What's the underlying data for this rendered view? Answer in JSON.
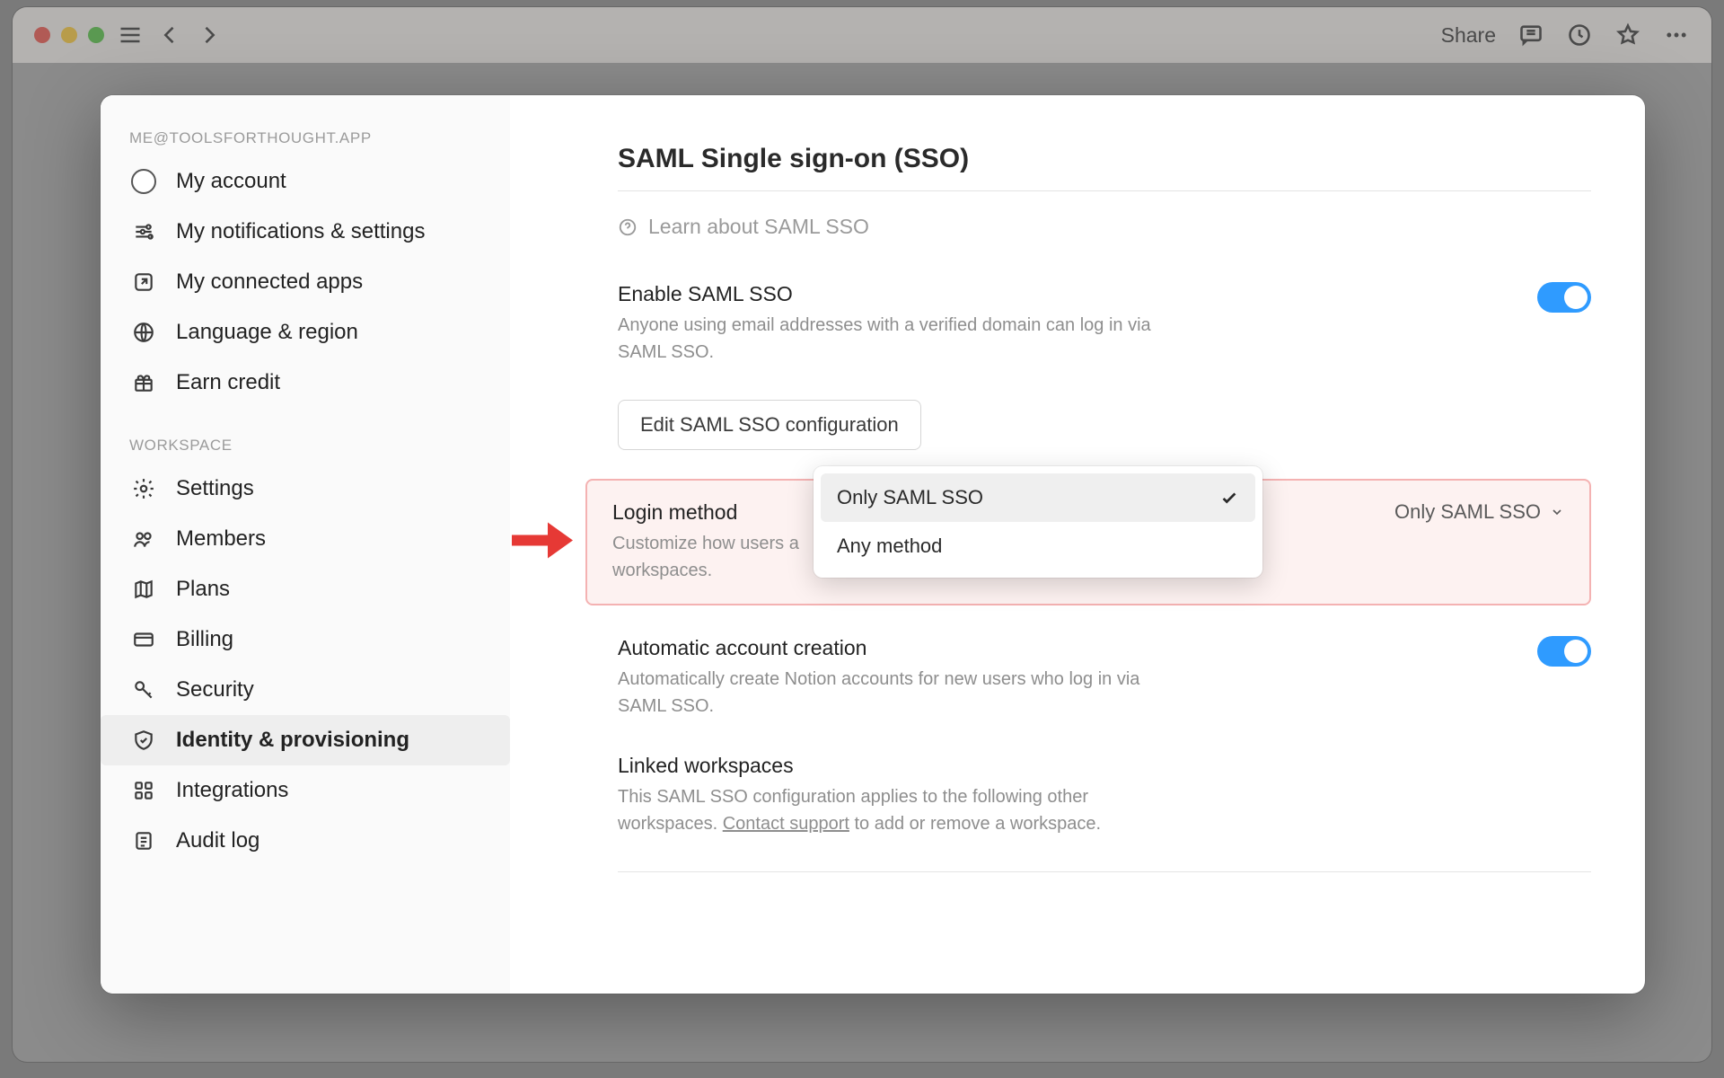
{
  "titlebar": {
    "share_label": "Share"
  },
  "sidebar": {
    "account_label": "ME@TOOLSFORTHOUGHT.APP",
    "workspace_label": "WORKSPACE",
    "account_items": [
      {
        "label": "My account"
      },
      {
        "label": "My notifications & settings"
      },
      {
        "label": "My connected apps"
      },
      {
        "label": "Language & region"
      },
      {
        "label": "Earn credit"
      }
    ],
    "workspace_items": [
      {
        "label": "Settings"
      },
      {
        "label": "Members"
      },
      {
        "label": "Plans"
      },
      {
        "label": "Billing"
      },
      {
        "label": "Security"
      },
      {
        "label": "Identity & provisioning"
      },
      {
        "label": "Integrations"
      },
      {
        "label": "Audit log"
      }
    ]
  },
  "main": {
    "title": "SAML Single sign-on (SSO)",
    "learn_link": "Learn about SAML SSO",
    "enable_section": {
      "label": "Enable SAML SSO",
      "desc": "Anyone using email addresses with a verified domain can log in via SAML SSO."
    },
    "config_button": "Edit SAML SSO configuration",
    "login_section": {
      "label": "Login method",
      "desc_pre": "Customize how users a",
      "desc_post": "workspaces.",
      "selected": "Only SAML SSO",
      "options": [
        "Only SAML SSO",
        "Any method"
      ]
    },
    "auto_section": {
      "label": "Automatic account creation",
      "desc": "Automatically create Notion accounts for new users who log in via SAML SSO."
    },
    "linked_section": {
      "label": "Linked workspaces",
      "desc_pre": "This SAML SSO configuration applies to the following other workspaces. ",
      "contact_link": "Contact support",
      "desc_post": " to add or remove a workspace."
    }
  }
}
